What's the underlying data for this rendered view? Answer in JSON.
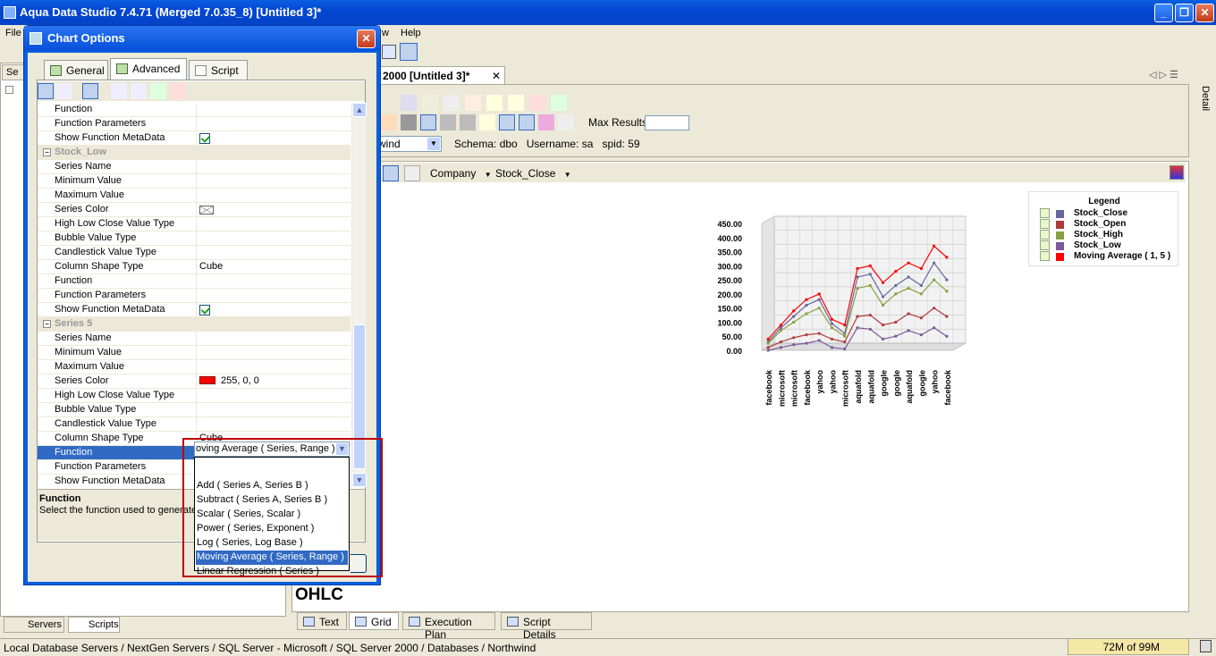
{
  "app": {
    "title": "Aqua Data Studio 7.4.71 (Merged 7.0.35_8) [Untitled 3]*"
  },
  "menubar": {
    "file": "File",
    "w": "w",
    "help": "Help"
  },
  "left_panel": {
    "tab1": "Se",
    "servers_tab": "Servers",
    "scripts_tab": "Scripts"
  },
  "document": {
    "tab_title": "r 2000 [Untitled 3]*",
    "max_results_label": "Max Results:",
    "max_results_value": "",
    "database": "wind",
    "schema_label": "Schema:",
    "schema": "dbo",
    "username_label": "Username:",
    "username": "sa",
    "spid_label": "spid:",
    "spid": "59",
    "right_panel_label": "Detail"
  },
  "chart_toolbar": {
    "company": "Company",
    "stock_close": "Stock_Close"
  },
  "bottom_tabs": [
    "Text",
    "Grid",
    "Execution Plan",
    "Script Details"
  ],
  "ohlc_label": "OHLC",
  "status": {
    "path": "Local Database Servers / NextGen Servers / SQL Server - Microsoft / SQL Server 2000 / Databases / Northwind",
    "memory": "72M of 99M"
  },
  "dialog": {
    "title": "Chart Options",
    "tabs": [
      "General",
      "Advanced",
      "Script"
    ],
    "rows": [
      {
        "k": "Function",
        "v": "",
        "type": "row"
      },
      {
        "k": "Function Parameters",
        "v": "",
        "type": "row"
      },
      {
        "k": "Show Function MetaData",
        "v": "",
        "type": "check"
      },
      {
        "k": "Stock_Low",
        "type": "sect"
      },
      {
        "k": "Series Name",
        "v": "",
        "type": "row"
      },
      {
        "k": "Minimum Value",
        "v": "",
        "type": "row"
      },
      {
        "k": "Maximum Value",
        "v": "",
        "type": "row"
      },
      {
        "k": "Series Color",
        "v": "",
        "type": "env"
      },
      {
        "k": "High Low Close Value Type",
        "v": "",
        "type": "row"
      },
      {
        "k": "Bubble Value Type",
        "v": "",
        "type": "row"
      },
      {
        "k": "Candlestick Value Type",
        "v": "",
        "type": "row"
      },
      {
        "k": "Column Shape Type",
        "v": "Cube",
        "type": "row"
      },
      {
        "k": "Function",
        "v": "",
        "type": "row"
      },
      {
        "k": "Function Parameters",
        "v": "",
        "type": "row"
      },
      {
        "k": "Show Function MetaData",
        "v": "",
        "type": "check"
      },
      {
        "k": "Series 5",
        "type": "sect"
      },
      {
        "k": "Series Name",
        "v": "",
        "type": "row"
      },
      {
        "k": "Minimum Value",
        "v": "",
        "type": "row"
      },
      {
        "k": "Maximum Value",
        "v": "",
        "type": "row"
      },
      {
        "k": "Series Color",
        "v": "255, 0, 0",
        "type": "color"
      },
      {
        "k": "High Low Close Value Type",
        "v": "",
        "type": "row"
      },
      {
        "k": "Bubble Value Type",
        "v": "",
        "type": "row"
      },
      {
        "k": "Candlestick Value Type",
        "v": "",
        "type": "row"
      },
      {
        "k": "Column Shape Type",
        "v": "Cube",
        "type": "row"
      },
      {
        "k": "Function",
        "v": "",
        "type": "selrow"
      },
      {
        "k": "Function Parameters",
        "v": "",
        "type": "row"
      },
      {
        "k": "Show Function MetaData",
        "v": "",
        "type": "row"
      }
    ],
    "desc_title": "Function",
    "desc_text": "Select the function used to generate",
    "dropdown_value": "oving Average ( Series, Range )",
    "dropdown_options": [
      "",
      "Add ( Series A, Series B )",
      "Subtract ( Series A, Series B )",
      "Scalar ( Series, Scalar )",
      "Power ( Series, Exponent )",
      "Log ( Series, Log Base )",
      "Moving Average ( Series, Range )",
      "Linear Regression ( Series )"
    ],
    "dropdown_selected": 6
  },
  "chart_data": {
    "type": "line",
    "title": "",
    "categories": [
      "facebook",
      "microsoft",
      "microsoft",
      "facebook",
      "yahoo",
      "yahoo",
      "microsoft",
      "aquafold",
      "aquafold",
      "google",
      "google",
      "aquafold",
      "google",
      "yahoo",
      "facebook"
    ],
    "yticks": [
      "450.00",
      "400.00",
      "350.00",
      "300.00",
      "250.00",
      "200.00",
      "150.00",
      "100.00",
      "50.00",
      "0.00"
    ],
    "ylim": [
      0,
      450
    ],
    "legend_title": "Legend",
    "legend_position": "top-right",
    "series": [
      {
        "name": "Stock_Close",
        "color": "#6666a0",
        "values": [
          30,
          80,
          120,
          160,
          180,
          95,
          60,
          260,
          270,
          190,
          230,
          260,
          230,
          310,
          250
        ]
      },
      {
        "name": "Stock_Open",
        "color": "#b03a3a",
        "values": [
          10,
          30,
          45,
          55,
          60,
          40,
          30,
          120,
          125,
          90,
          100,
          130,
          115,
          150,
          120
        ]
      },
      {
        "name": "Stock_High",
        "color": "#88a040",
        "values": [
          25,
          70,
          100,
          130,
          150,
          80,
          50,
          220,
          230,
          160,
          200,
          220,
          200,
          250,
          210
        ]
      },
      {
        "name": "Stock_Low",
        "color": "#7a5a9a",
        "values": [
          0,
          10,
          20,
          25,
          35,
          10,
          5,
          80,
          75,
          40,
          50,
          70,
          55,
          80,
          50
        ]
      },
      {
        "name": "Moving Average ( 1, 5 )",
        "color": "#ff0000",
        "values": [
          40,
          90,
          140,
          180,
          200,
          110,
          90,
          290,
          300,
          240,
          280,
          310,
          290,
          370,
          330
        ]
      }
    ]
  }
}
